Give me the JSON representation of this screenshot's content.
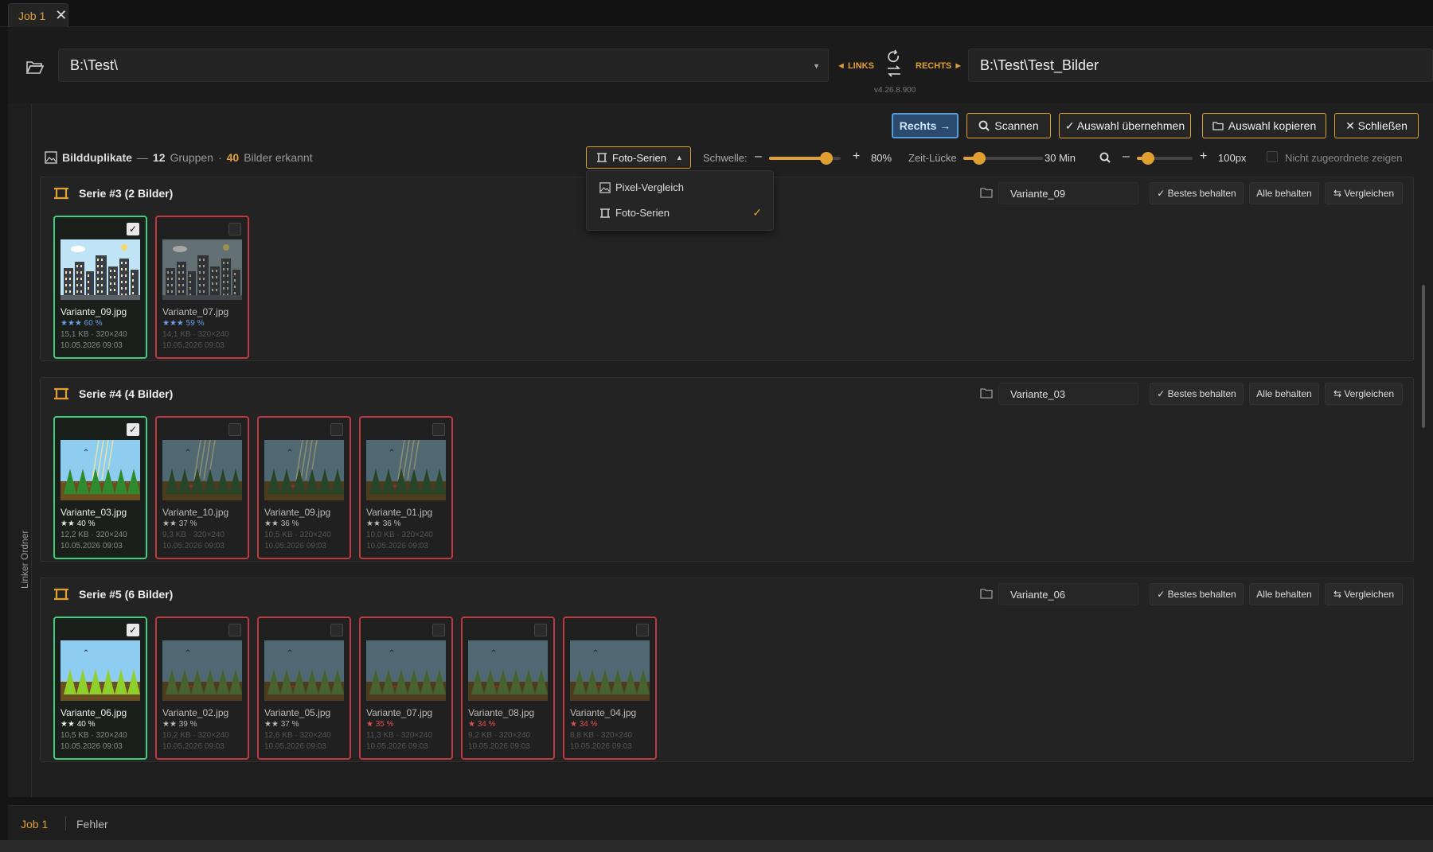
{
  "tab": {
    "label": "Job 1"
  },
  "left_path": "B:\\Test\\",
  "right_path": "B:\\Test\\Test_Bilder",
  "links_label": "◄ LINKS",
  "rechts_label": "RECHTS ►",
  "version": "v4.26.8.900",
  "sidebar_label": "Linker Ordner",
  "toolbar": {
    "rechts": "Rechts →",
    "scan": "Scannen",
    "apply": "✓ Auswahl übernehmen",
    "copy": "Auswahl kopieren",
    "close": "✕ Schließen"
  },
  "stats": {
    "title": "Bildduplikate",
    "dash": "—",
    "groups": "12",
    "groups_label": "Gruppen",
    "dot": "·",
    "images": "40",
    "images_label": "Bilder erkannt"
  },
  "mode_button": "Foto-Serien",
  "threshold": {
    "label": "Schwelle:",
    "value": "80%",
    "fraction": 0.8
  },
  "time_gap": {
    "label": "Zeit-Lücke",
    "value": "30 Min",
    "fraction": 0.2
  },
  "zoom": {
    "value": "100px",
    "fraction": 0.2
  },
  "unassigned": "Nicht zugeordnete zeigen",
  "dropdown": [
    "Pixel-Vergleich",
    "Foto-Serien"
  ],
  "group_buttons": {
    "best": "✓ Bestes behalten",
    "all": "Alle behalten",
    "compare": "⇆ Vergleichen"
  },
  "groups": [
    {
      "title": "Serie #3 (2 Bilder)",
      "selected": "Variante_09",
      "cards": [
        {
          "file": "Variante_09.jpg",
          "score": "★★★ 60 %",
          "meta": "15,1 KB · 320×240",
          "date": "10.05.2026 09:03"
        },
        {
          "file": "Variante_07.jpg",
          "score": "★★★ 59 %",
          "meta": "14,1 KB · 320×240",
          "date": "10.05.2026 09:03"
        }
      ]
    },
    {
      "title": "Serie #4 (4 Bilder)",
      "selected": "Variante_03",
      "cards": [
        {
          "file": "Variante_03.jpg",
          "score": "★★ 40 %",
          "meta": "12,2 KB · 320×240",
          "date": "10.05.2026 09:03"
        },
        {
          "file": "Variante_10.jpg",
          "score": "★★ 37 %",
          "meta": "9,3 KB · 320×240",
          "date": "10.05.2026 09:03"
        },
        {
          "file": "Variante_09.jpg",
          "score": "★★ 36 %",
          "meta": "10,5 KB · 320×240",
          "date": "10.05.2026 09:03"
        },
        {
          "file": "Variante_01.jpg",
          "score": "★★ 36 %",
          "meta": "10,0 KB · 320×240",
          "date": "10.05.2026 09:03"
        }
      ]
    },
    {
      "title": "Serie #5 (6 Bilder)",
      "selected": "Variante_06",
      "cards": [
        {
          "file": "Variante_06.jpg",
          "score": "★★ 40 %",
          "meta": "10,5 KB · 320×240",
          "date": "10.05.2026 09:03"
        },
        {
          "file": "Variante_02.jpg",
          "score": "★★ 39 %",
          "meta": "10,2 KB · 320×240",
          "date": "10.05.2026 09:03"
        },
        {
          "file": "Variante_05.jpg",
          "score": "★★ 37 %",
          "meta": "12,6 KB · 320×240",
          "date": "10.05.2026 09:03"
        },
        {
          "file": "Variante_07.jpg",
          "score": "★ 35 %",
          "meta": "11,3 KB · 320×240",
          "date": "10.05.2026 09:03"
        },
        {
          "file": "Variante_08.jpg",
          "score": "★ 34 %",
          "meta": "9,2 KB · 320×240",
          "date": "10.05.2026 09:03"
        },
        {
          "file": "Variante_04.jpg",
          "score": "★ 34 %",
          "meta": "8,8 KB · 320×240",
          "date": "10.05.2026 09:03"
        }
      ]
    }
  ],
  "statusbar": {
    "job": "Job 1",
    "errors": "Fehler"
  },
  "colors": {
    "accent": "#e0a030",
    "keep": "#3fce7a",
    "drop": "#c0393b",
    "primary": "#5b9bd5"
  }
}
